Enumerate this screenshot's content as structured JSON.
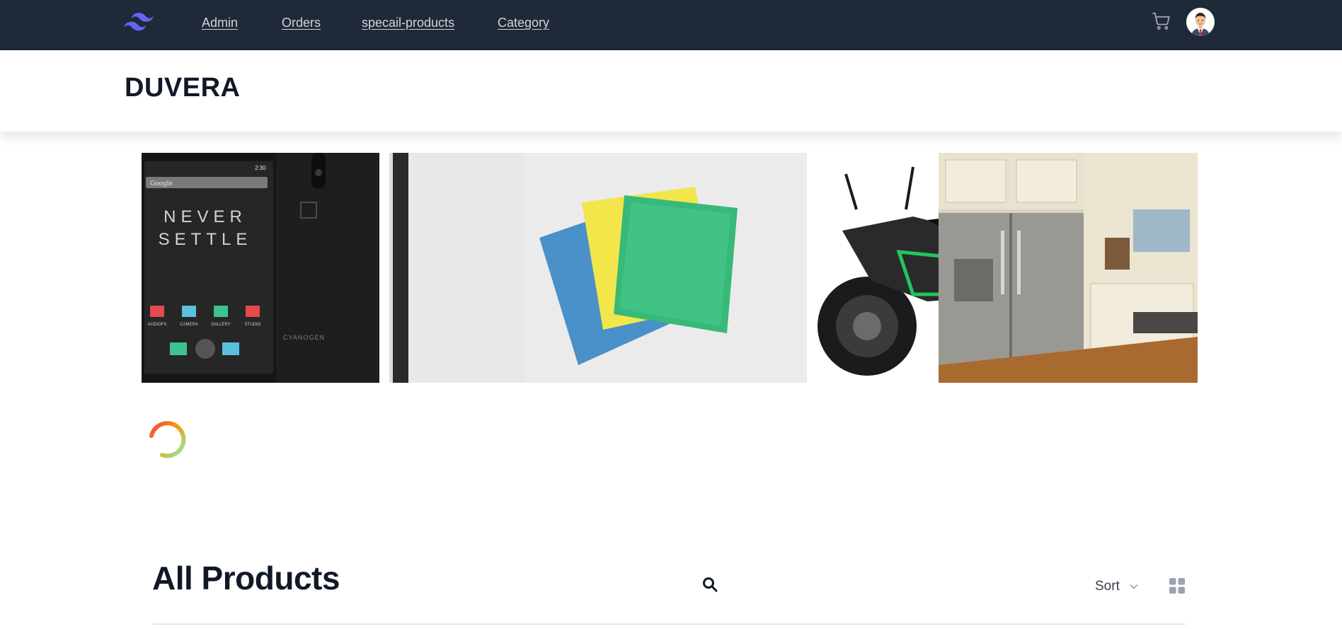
{
  "nav": {
    "logo": "tailwind-logo-icon",
    "links": [
      "Admin",
      "Orders",
      "specail-products",
      "Category"
    ],
    "cart_icon": "cart-icon",
    "avatar_icon": "user-avatar-icon"
  },
  "header": {
    "brand": "DUVERA"
  },
  "carousel": {
    "slides": [
      {
        "icon": "smartphone-image"
      },
      {
        "icon": "microfiber-cloths-image"
      },
      {
        "icon": "motorcycle-image"
      },
      {
        "icon": "refrigerator-image"
      }
    ],
    "phone_screen": {
      "status_time": "2:30",
      "search_text": "Google",
      "headline_line1": "NEVER",
      "headline_line2": "SETTLE",
      "apps": [
        "AUDIOFX",
        "CAMERA",
        "GALLERY",
        "STUDIO"
      ],
      "back_brand": "CYANOGEN"
    }
  },
  "loading": {
    "icon": "loading-spinner-icon"
  },
  "products": {
    "title": "All Products",
    "search_icon": "search-icon",
    "sort_label": "Sort",
    "sort_icon": "chevron-down-icon",
    "view_icon": "grid-view-icon"
  },
  "colors": {
    "nav_bg": "#1f2937",
    "nav_link": "#d1d5db",
    "logo": "#6366f1",
    "heading": "#111827",
    "spinner_start": "#ef4444",
    "spinner_end": "#86efac"
  }
}
